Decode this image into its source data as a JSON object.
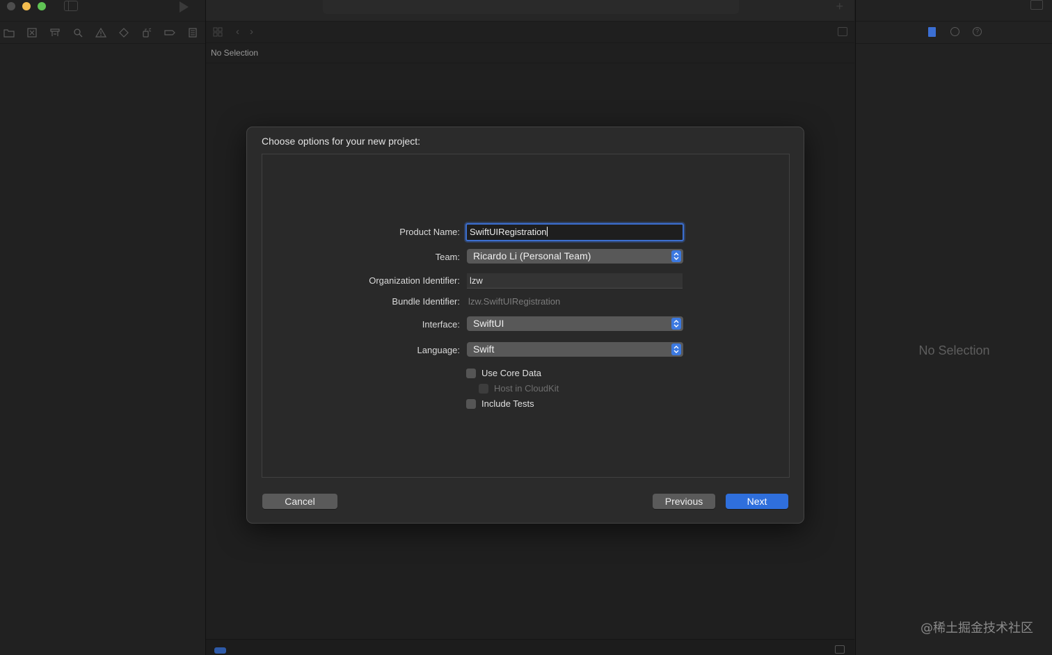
{
  "editor": {
    "jumpbar": "No Selection"
  },
  "inspector": {
    "empty_text": "No Selection"
  },
  "sheet": {
    "title": "Choose options for your new project:",
    "fields": {
      "product_name": {
        "label": "Product Name:",
        "value": "SwiftUIRegistration"
      },
      "team": {
        "label": "Team:",
        "value": "Ricardo Li (Personal Team)"
      },
      "organization_identifier": {
        "label": "Organization Identifier:",
        "value": "lzw"
      },
      "bundle_identifier": {
        "label": "Bundle Identifier:",
        "value": "lzw.SwiftUIRegistration"
      },
      "interface": {
        "label": "Interface:",
        "value": "SwiftUI"
      },
      "language": {
        "label": "Language:",
        "value": "Swift"
      }
    },
    "checkboxes": {
      "use_core_data": {
        "label": "Use Core Data",
        "checked": false,
        "enabled": true
      },
      "host_in_cloudkit": {
        "label": "Host in CloudKit",
        "checked": false,
        "enabled": false
      },
      "include_tests": {
        "label": "Include Tests",
        "checked": false,
        "enabled": true
      }
    },
    "buttons": {
      "cancel": "Cancel",
      "previous": "Previous",
      "next": "Next"
    }
  },
  "watermark": "@稀土掘金技术社区",
  "colors": {
    "accent": "#2f6fdc",
    "focus_ring": "#3c6fd1",
    "close": "#4d4d4d",
    "minimize": "#f4bd4f",
    "maximize": "#5fc454"
  }
}
